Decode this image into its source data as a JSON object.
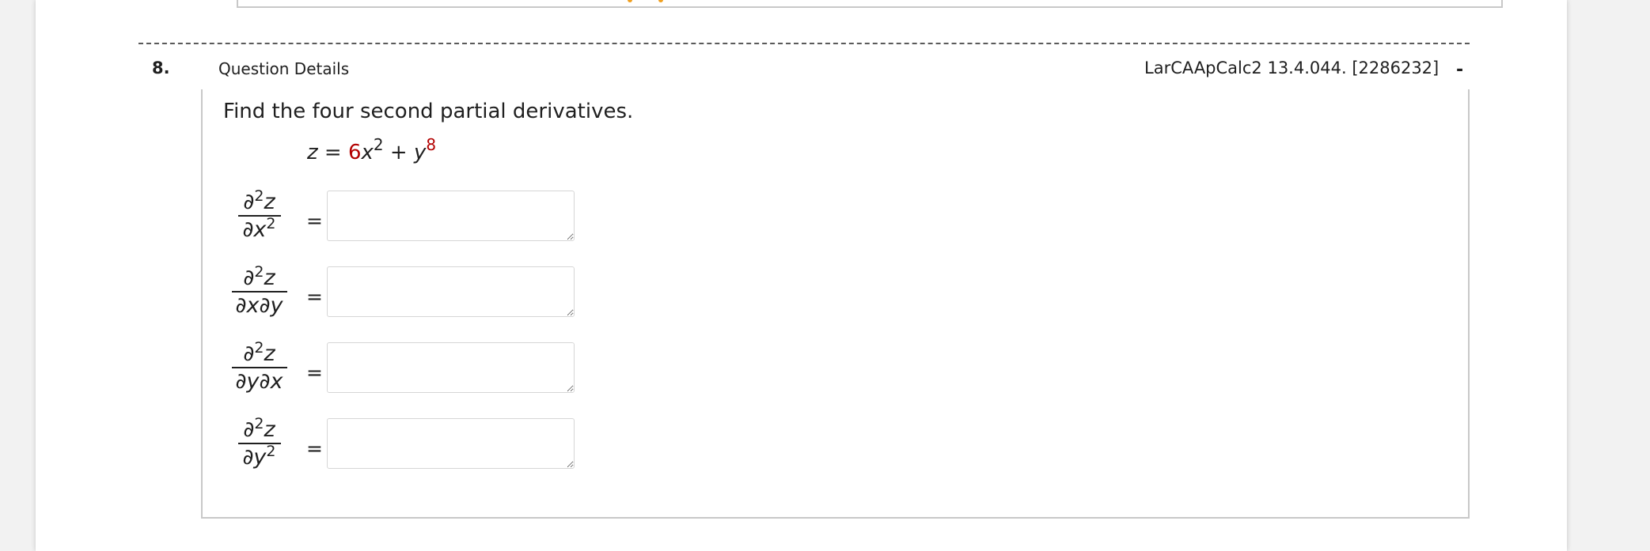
{
  "question": {
    "number": "8.",
    "details_label": "Question Details",
    "reference": "LarCAApCalc2 13.4.044. [2286232]",
    "collapse_symbol": "-"
  },
  "prompt": "Find the four second partial derivatives.",
  "equation": {
    "lhs": "z",
    "equals": "=",
    "coef": "6",
    "x_var": "x",
    "x_exp": "2",
    "plus": "+",
    "y_var": "y",
    "y_exp": "8"
  },
  "partials": [
    {
      "num": "∂",
      "num_sup": "2",
      "num_var": "z",
      "den": "∂x",
      "den_sup": "2",
      "den_tail": "",
      "value": ""
    },
    {
      "num": "∂",
      "num_sup": "2",
      "num_var": "z",
      "den": "∂x∂y",
      "den_sup": "",
      "den_tail": "",
      "value": ""
    },
    {
      "num": "∂",
      "num_sup": "2",
      "num_var": "z",
      "den": "∂y∂x",
      "den_sup": "",
      "den_tail": "",
      "value": ""
    },
    {
      "num": "∂",
      "num_sup": "2",
      "num_var": "z",
      "den": "∂y",
      "den_sup": "2",
      "den_tail": "",
      "value": ""
    }
  ],
  "equals_sign": "=",
  "colors": {
    "given_value": "#b30000",
    "separator": "#5a5a5a",
    "box_border": "#c8c8c8"
  }
}
